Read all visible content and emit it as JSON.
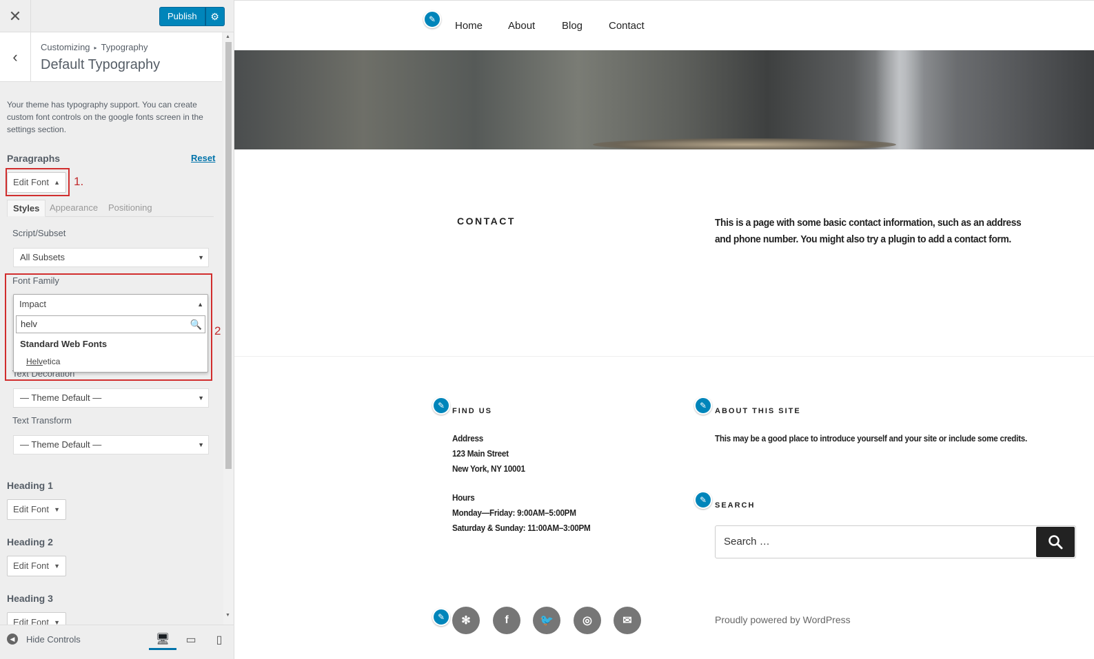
{
  "customizer": {
    "close_icon": "✕",
    "publish_label": "Publish",
    "gear_icon": "⚙",
    "breadcrumb": {
      "parent": "Customizing",
      "separator": "▸",
      "current": "Typography"
    },
    "back_icon": "‹",
    "section_title": "Default Typography",
    "description": "Your theme has typography support. You can create custom font controls on the google fonts screen in the settings section.",
    "paragraphs": {
      "label": "Paragraphs",
      "reset_label": "Reset",
      "edit_font_label": "Edit Font",
      "caret_up": "▲",
      "tabs": [
        "Styles",
        "Appearance",
        "Positioning"
      ],
      "script_subset_label": "Script/Subset",
      "script_subset_value": "All Subsets",
      "font_family_label": "Font Family",
      "font_family_value": "Impact",
      "search_value": "helv",
      "search_icon": "🔍",
      "option_group": "Standard Web Fonts",
      "option_match": "Helv",
      "option_rest": "etica",
      "text_decoration_label": "Text Decoration",
      "text_decoration_value": "— Theme Default —",
      "text_transform_label": "Text Transform",
      "text_transform_value": "— Theme Default —"
    },
    "heading1": {
      "label": "Heading 1",
      "edit_font_label": "Edit Font"
    },
    "heading2": {
      "label": "Heading 2",
      "edit_font_label": "Edit Font"
    },
    "heading3": {
      "label": "Heading 3",
      "edit_font_label": "Edit Font"
    },
    "caret_down": "▼",
    "annotations": {
      "one": "1.",
      "two": "2."
    },
    "footer": {
      "hide_controls_label": "Hide Controls",
      "hide_icon": "◀",
      "desktop_icon": "🖥",
      "tablet_icon": "▭",
      "mobile_icon": "▯"
    }
  },
  "preview": {
    "pencil_icon": "✎",
    "nav": [
      "Home",
      "About",
      "Blog",
      "Contact"
    ],
    "page_heading": "CONTACT",
    "page_text": "This is a page with some basic contact information, such as an address and phone number. You might also try a plugin to add a contact form.",
    "find_us": {
      "title": "FIND US",
      "address_label": "Address",
      "address_line1": "123 Main Street",
      "address_line2": "New York, NY 10001",
      "hours_label": "Hours",
      "hours_line1": "Monday—Friday: 9:00AM–5:00PM",
      "hours_line2": "Saturday & Sunday: 11:00AM–3:00PM"
    },
    "about": {
      "title": "ABOUT THIS SITE",
      "text": "This may be a good place to introduce yourself and your site or include some credits."
    },
    "search": {
      "title": "SEARCH",
      "placeholder": "Search …",
      "button_icon": "⚲"
    },
    "social_icons": [
      "yelp-icon",
      "facebook-icon",
      "twitter-icon",
      "instagram-icon",
      "email-icon"
    ],
    "social_glyphs": [
      "✻",
      "f",
      "🐦",
      "◎",
      "✉"
    ],
    "powered_by": "Proudly powered by WordPress"
  }
}
